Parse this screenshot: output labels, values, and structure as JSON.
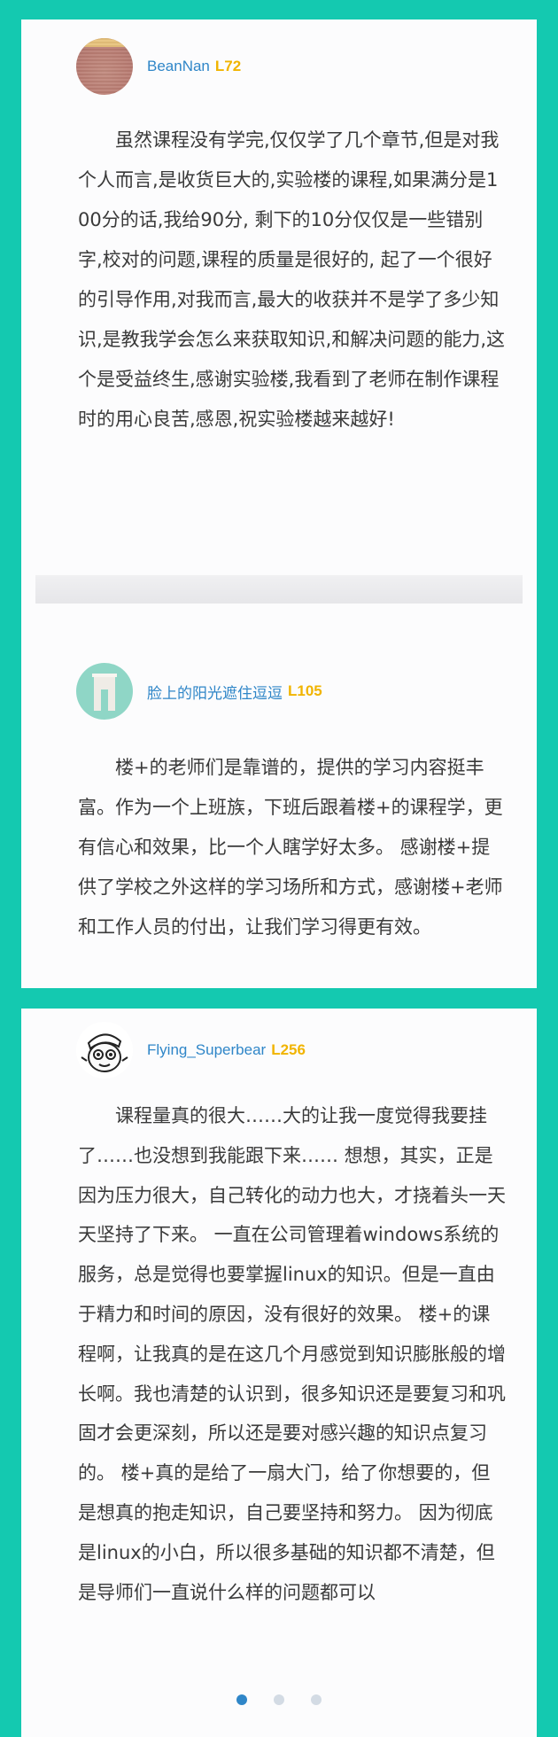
{
  "reviews": [
    {
      "username": "BeanNan",
      "level": "L72",
      "avatar_icon": "avatar-brown-icon",
      "text": "虽然课程没有学完,仅仅学了几个章节,但是对我个人而言,是收货巨大的,实验楼的课程,如果满分是100分的话,我给90分, 剩下的10分仅仅是一些错别字,校对的问题,课程的质量是很好的, 起了一个很好的引导作用,对我而言,最大的收获并不是学了多少知识,是教我学会怎么来获取知识,和解决问题的能力,这个是受益终生,感谢实验楼,我看到了老师在制作课程时的用心良苦,感恩,祝实验楼越来越好!"
    },
    {
      "username": "脸上的阳光遮住逗逗",
      "level": "L105",
      "avatar_icon": "avatar-teal-icon",
      "text": "楼+的老师们是靠谱的，提供的学习内容挺丰富。作为一个上班族，下班后跟着楼+的课程学，更有信心和效果，比一个人瞎学好太多。 感谢楼+提供了学校之外这样的学习场所和方式，感谢楼+老师和工作人员的付出，让我们学习得更有效。"
    },
    {
      "username": "Flying_Superbear",
      "level": "L256",
      "avatar_icon": "avatar-cartoon-bear-icon",
      "text": "课程量真的很大……大的让我一度觉得我要挂了……也没想到我能跟下来…… 想想，其实，正是因为压力很大，自己转化的动力也大，才挠着头一天天坚持了下来。 一直在公司管理着windows系统的服务，总是觉得也要掌握linux的知识。但是一直由于精力和时间的原因，没有很好的效果。 楼+的课程啊，让我真的是在这几个月感觉到知识膨胀般的增长啊。我也清楚的认识到，很多知识还是要复习和巩固才会更深刻，所以还是要对感兴趣的知识点复习的。 楼+真的是给了一扇大门，给了你想要的，但是想真的抱走知识，自己要坚持和努力。 因为彻底是linux的小白，所以很多基础的知识都不清楚，但是导师们一直说什么样的问题都可以"
    }
  ],
  "pagination": {
    "count": 3,
    "active": 1
  },
  "colors": {
    "background": "#14c9b0",
    "username": "#2f86c8",
    "level": "#f1b400"
  }
}
